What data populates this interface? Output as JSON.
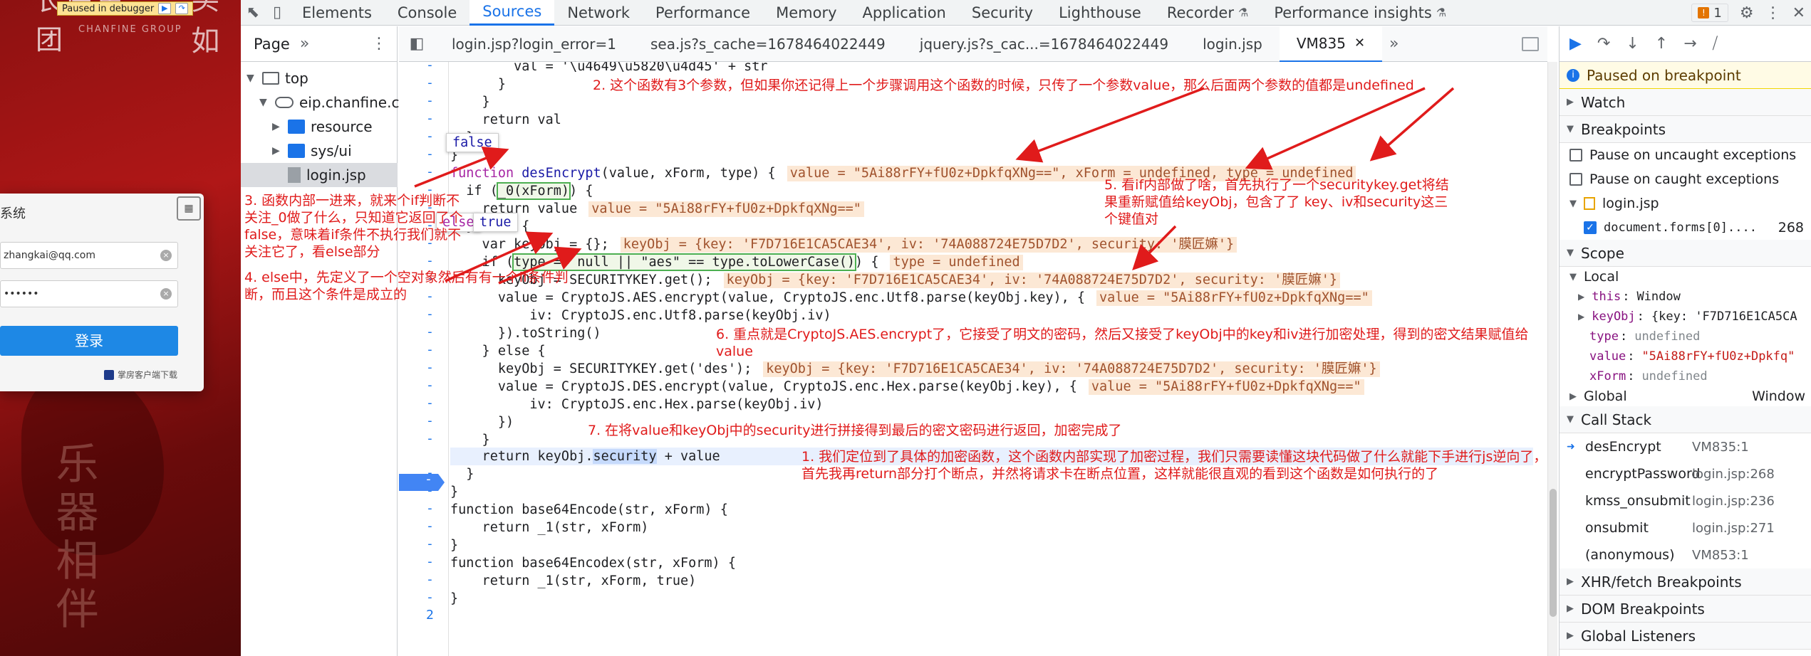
{
  "webpage": {
    "debugger_badge": "Paused in debugger",
    "brand_name": "长房集团",
    "brand_sub": "CHANFINE GROUP",
    "brand_right": "买如",
    "login_title": "系统",
    "username": "zhangkai@qq.com",
    "password_mask": "••••••",
    "login_button": "登录",
    "download_link": "掌房客户端下载",
    "bg_text": "乐器相伴"
  },
  "devtools": {
    "tabs": [
      "Elements",
      "Console",
      "Sources",
      "Network",
      "Performance",
      "Memory",
      "Application",
      "Security",
      "Lighthouse",
      "Recorder",
      "Performance insights"
    ],
    "active_tab": "Sources",
    "issues_count": "1"
  },
  "navigator": {
    "tab_label": "Page",
    "items": [
      {
        "label": "top",
        "type": "frame"
      },
      {
        "label": "eip.chanfine.cc",
        "type": "cloud"
      },
      {
        "label": "resource",
        "type": "folder"
      },
      {
        "label": "sys/ui",
        "type": "folder"
      },
      {
        "label": "login.jsp",
        "type": "file"
      }
    ]
  },
  "editor": {
    "file_tabs": [
      "login.jsp?login_error=1",
      "sea.js?s_cache=1678464022449",
      "jquery.js?s_cac...=1678464022449",
      "login.jsp",
      "VM835"
    ],
    "active_file": "VM835",
    "gutter_last": "2",
    "code": {
      "l0": "        val = '\\u4649\\u5820\\u4d45' + str",
      "l1": "      }",
      "l2": "    }",
      "l3": "    return val",
      "l4": "  }",
      "l5": "}",
      "l6_a": "function ",
      "l6_b": "desEncrypt",
      "l6_c": "(value, xForm, type) {",
      "l6_inline": "value = \"5Ai88rFY+fU0z+DpkfqXNg==\", xForm = undefined, type = undefined",
      "l7_a": "  if (",
      "l7_b": "_0(xForm)",
      "l7_c": ") {",
      "l8": "    return value",
      "l8_inline": "value = \"5Ai88rFY+fU0z+DpkfqXNg==\"",
      "l9": "  } else {",
      "l10": "    var keyObj = {};",
      "l10_inline": "keyObj = {key: 'F7D716E1CA5CAE34', iv: '74A088724E75D7D2', security: '膜匠嫲'}",
      "l11_a": "    if (",
      "l11_b": "type == null || \"aes\" == type.toLowerCase()",
      "l11_c": ") {",
      "l11_inline": "type = undefined",
      "l12": "      keyObj = SECURITYKEY.get();",
      "l12_inline": "keyObj = {key: 'F7D716E1CA5CAE34', iv: '74A088724E75D7D2', security: '膜匠嫲'}",
      "l13": "      value = CryptoJS.AES.encrypt(value, CryptoJS.enc.Utf8.parse(keyObj.key), {",
      "l13_inline": "value = \"5Ai88rFY+fU0z+DpkfqXNg==\"",
      "l14": "          iv: CryptoJS.enc.Utf8.parse(keyObj.iv)",
      "l15": "      }).toString()",
      "l16": "    } else {",
      "l17": "      keyObj = SECURITYKEY.get('des');",
      "l17_inline": "keyObj = {key: 'F7D716E1CA5CAE34', iv: '74A088724E75D7D2', security: '膜匠嫲'}",
      "l18": "      value = CryptoJS.DES.encrypt(value, CryptoJS.enc.Hex.parse(keyObj.key), {",
      "l18_inline": "value = \"5Ai88rFY+fU0z+DpkfqXNg==\"",
      "l19": "          iv: CryptoJS.enc.Hex.parse(keyObj.iv)",
      "l20": "      })",
      "l21": "    }",
      "l22_a": "    return keyObj.",
      "l22_b": "security",
      "l22_c": " + value",
      "l23": "  }",
      "l24": "}",
      "l25": "function base64Encode(str, xForm) {",
      "l26": "    return _1(str, xForm)",
      "l27": "}",
      "l28": "function base64Encodex(str, xForm) {",
      "l29": "    return _1(str, xForm, true)",
      "l30": "}"
    },
    "popups": {
      "false_pop": "false",
      "true_pop": "true",
      "else_pop": "else"
    }
  },
  "annotations": {
    "a1": "1. 我们定位到了具体的加密函数，这个函数内部实现了加密过程，我们只需要读懂这块代码做了什么就能下手进行js逆向了，首先我再return部分打个断点，并然将请求卡在断点位置，这样就能很直观的看到这个函数是如何执行的了",
    "a2": "2. 这个函数有3个参数，但如果你还记得上一个步骤调用这个函数的时候，只传了一个参数value，那么后面两个参数的值都是undefined",
    "a3": "3. 函数内部一进来，就来个if判断不关注_0做了什么，只知道它返回了个false，意味着if条件不执行我们就不关注它了，看else部分",
    "a4": "4. else中，先定义了一个空对象然后有有一个if条件判断，而且这个条件是成立的",
    "a5": "5. 看if内部做了啥，首先执行了一个securitykey.get将结果重新赋值给keyObj，包含了了 key、iv和security这三个键值对",
    "a6": "6. 重点就是CryptoJS.AES.encrypt了，它接受了明文的密码，然后又接受了keyObj中的key和iv进行加密处理，得到的密文结果赋值给value",
    "a7": "7. 在将value和keyObj中的security进行拼接得到最后的密文密码进行返回，加密完成了"
  },
  "debugger": {
    "paused_msg": "Paused on breakpoint",
    "watch": "Watch",
    "breakpoints": "Breakpoints",
    "pause_uncaught": "Pause on uncaught exceptions",
    "pause_caught": "Pause on caught exceptions",
    "bp_file": "login.jsp",
    "bp_code": "document.forms[0]....",
    "bp_line": "268",
    "scope": "Scope",
    "local": "Local",
    "scope_vars": [
      {
        "name": "this",
        "sep": ":",
        "value": "Window",
        "kind": "plain",
        "expand": true
      },
      {
        "name": "keyObj",
        "sep": ":",
        "value": "{key: 'F7D716E1CA5CA",
        "kind": "plain",
        "expand": true
      },
      {
        "name": "type",
        "sep": ":",
        "value": "undefined",
        "kind": "u",
        "expand": false
      },
      {
        "name": "value",
        "sep": ":",
        "value": "\"5Ai88rFY+fU0z+Dpkfq\"",
        "kind": "s",
        "expand": false
      },
      {
        "name": "xForm",
        "sep": ":",
        "value": "undefined",
        "kind": "u",
        "expand": false
      }
    ],
    "global": "Global",
    "global_val": "Window",
    "call_stack": "Call Stack",
    "frames": [
      {
        "fn": "desEncrypt",
        "loc": "VM835:1"
      },
      {
        "fn": "encryptPassword",
        "loc": "login.jsp:268"
      },
      {
        "fn": "kmss_onsubmit",
        "loc": "login.jsp:236"
      },
      {
        "fn": "onsubmit",
        "loc": "login.jsp:271"
      },
      {
        "fn": "(anonymous)",
        "loc": "VM853:1"
      }
    ],
    "xhr": "XHR/fetch Breakpoints",
    "dom": "DOM Breakpoints",
    "global_listeners": "Global Listeners"
  }
}
